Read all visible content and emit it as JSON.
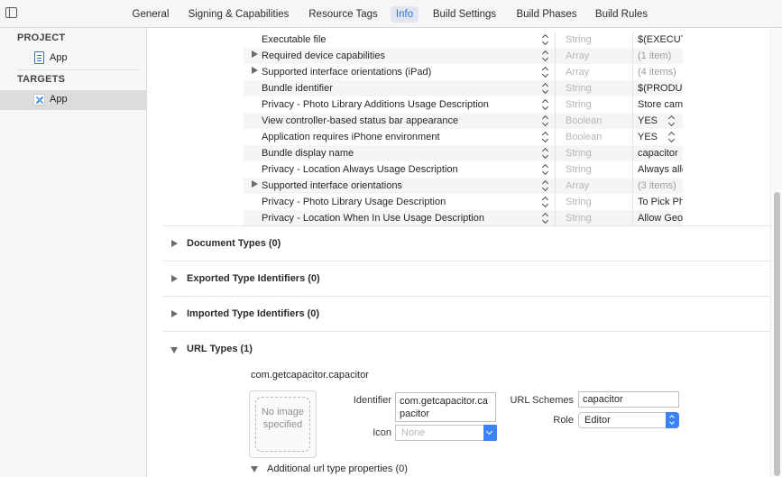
{
  "tabs": [
    {
      "label": "General",
      "active": false
    },
    {
      "label": "Signing & Capabilities",
      "active": false
    },
    {
      "label": "Resource Tags",
      "active": false
    },
    {
      "label": "Info",
      "active": true
    },
    {
      "label": "Build Settings",
      "active": false
    },
    {
      "label": "Build Phases",
      "active": false
    },
    {
      "label": "Build Rules",
      "active": false
    }
  ],
  "sidebar": {
    "project_header": "PROJECT",
    "project_item": "App",
    "targets_header": "TARGETS",
    "target_item": "App"
  },
  "plist": {
    "rows": [
      {
        "key": "Executable file",
        "type": "String",
        "value": "$(EXECUTABLE_NAME)",
        "expandable": false,
        "value_grey": false,
        "value_stepper": false
      },
      {
        "key": "Required device capabilities",
        "type": "Array",
        "value": "(1 item)",
        "expandable": true,
        "value_grey": true,
        "value_stepper": false
      },
      {
        "key": "Supported interface orientations (iPad)",
        "type": "Array",
        "value": "(4 items)",
        "expandable": true,
        "value_grey": true,
        "value_stepper": false
      },
      {
        "key": "Bundle identifier",
        "type": "String",
        "value": "$(PRODUCT_BUNDLE_IDENTIFIER)",
        "expandable": false,
        "value_grey": false,
        "value_stepper": false
      },
      {
        "key": "Privacy - Photo Library Additions Usage Description",
        "type": "String",
        "value": "Store camera photos",
        "expandable": false,
        "value_grey": false,
        "value_stepper": false
      },
      {
        "key": "View controller-based status bar appearance",
        "type": "Boolean",
        "value": "YES",
        "expandable": false,
        "value_grey": false,
        "value_stepper": true
      },
      {
        "key": "Application requires iPhone environment",
        "type": "Boolean",
        "value": "YES",
        "expandable": false,
        "value_grey": false,
        "value_stepper": true
      },
      {
        "key": "Bundle display name",
        "type": "String",
        "value": "capacitor",
        "expandable": false,
        "value_grey": false,
        "value_stepper": false
      },
      {
        "key": "Privacy - Location Always Usage Description",
        "type": "String",
        "value": "Always allow",
        "expandable": false,
        "value_grey": false,
        "value_stepper": false
      },
      {
        "key": "Supported interface orientations",
        "type": "Array",
        "value": "(3 items)",
        "expandable": true,
        "value_grey": true,
        "value_stepper": false
      },
      {
        "key": "Privacy - Photo Library Usage Description",
        "type": "String",
        "value": "To Pick Photos",
        "expandable": false,
        "value_grey": false,
        "value_stepper": false
      },
      {
        "key": "Privacy - Location When In Use Usage Description",
        "type": "String",
        "value": "Allow Geolocation",
        "expandable": false,
        "value_grey": false,
        "value_stepper": false
      }
    ]
  },
  "sections": {
    "document_types": "Document Types (0)",
    "exported_types": "Exported Type Identifiers (0)",
    "imported_types": "Imported Type Identifiers (0)",
    "url_types": "URL Types (1)"
  },
  "url_type": {
    "name": "com.getcapacitor.capacitor",
    "image_placeholder": "No image specified",
    "identifier_label": "Identifier",
    "identifier_value": "com.getcapacitor.capacitor",
    "icon_label": "Icon",
    "icon_placeholder": "None",
    "url_schemes_label": "URL Schemes",
    "url_schemes_value": "capacitor",
    "role_label": "Role",
    "role_value": "Editor",
    "additional_properties": "Additional url type properties (0)"
  },
  "colors": {
    "accent": "#3b82f6",
    "active_tab_text": "#2f6fdc",
    "active_tab_bg": "#dfe6f2"
  }
}
